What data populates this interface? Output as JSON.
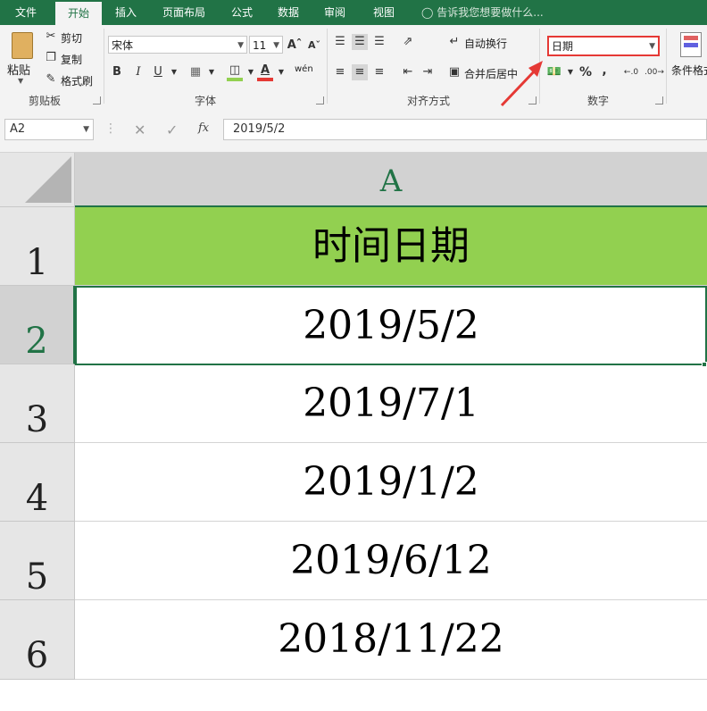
{
  "tabs": [
    "文件",
    "开始",
    "插入",
    "页面布局",
    "公式",
    "数据",
    "审阅",
    "视图"
  ],
  "tell_me": "告诉我您想要做什么...",
  "clipboard": {
    "paste": "粘贴",
    "cut": "剪切",
    "copy": "复制",
    "format_painter": "格式刷",
    "label": "剪贴板"
  },
  "font": {
    "name": "宋体",
    "size": "11",
    "bold": "B",
    "italic": "I",
    "underline": "U",
    "label": "字体",
    "wen": "wén"
  },
  "alignment": {
    "wrap": "自动换行",
    "merge": "合并后居中",
    "label": "对齐方式"
  },
  "number": {
    "format": "日期",
    "percent": "%",
    "comma": ",",
    "label": "数字"
  },
  "styles": {
    "conditional": "条件格式"
  },
  "formula_bar": {
    "name_box": "A2",
    "fx": "fx",
    "value": "2019/5/2"
  },
  "sheet": {
    "column": "A",
    "rows": [
      "1",
      "2",
      "3",
      "4",
      "5",
      "6"
    ],
    "cells": [
      "时间日期",
      "2019/5/2",
      "2019/7/1",
      "2019/1/2",
      "2019/6/12",
      "2018/11/22"
    ]
  },
  "colors": {
    "accent": "#217346",
    "header_fill": "#92d050",
    "highlight": "#e53935"
  }
}
